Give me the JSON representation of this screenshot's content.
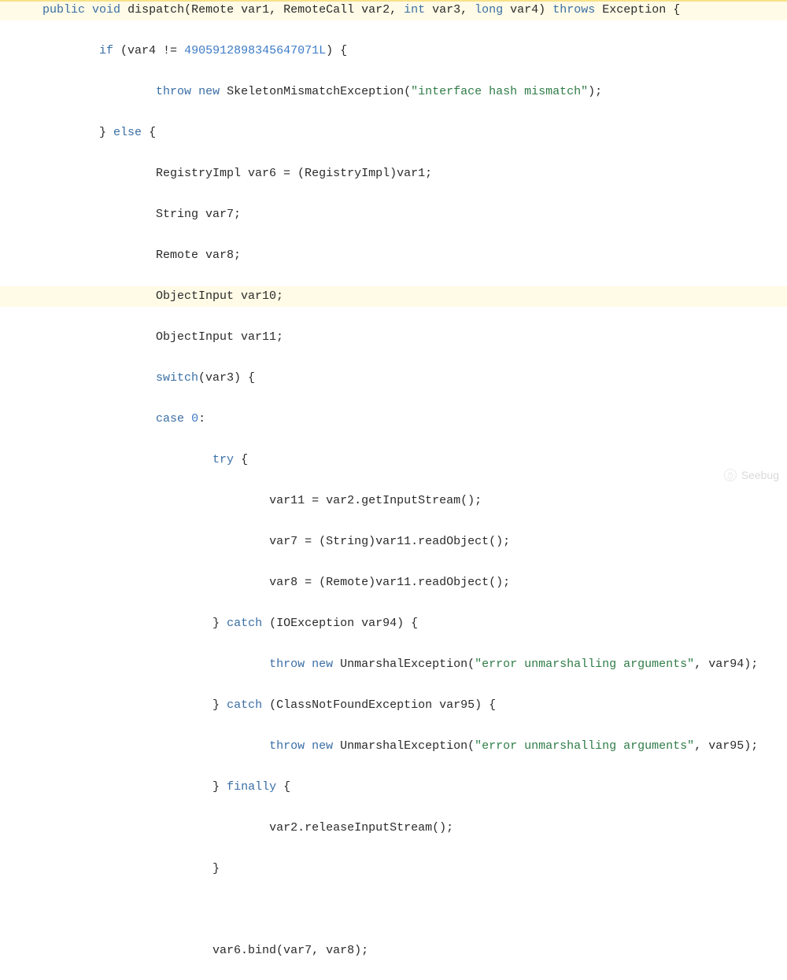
{
  "code": {
    "lines": [
      {
        "hl": "top",
        "indent": 1,
        "tokens": [
          {
            "c": "kw",
            "t": "public"
          },
          {
            "c": "plain",
            "t": " "
          },
          {
            "c": "kw",
            "t": "void"
          },
          {
            "c": "plain",
            "t": " dispatch(Remote var1, RemoteCall var2, "
          },
          {
            "c": "kw",
            "t": "int"
          },
          {
            "c": "plain",
            "t": " var3, "
          },
          {
            "c": "kw",
            "t": "long"
          },
          {
            "c": "plain",
            "t": " var4) "
          },
          {
            "c": "kw",
            "t": "throws"
          },
          {
            "c": "plain",
            "t": " Exception {"
          }
        ]
      },
      {
        "indent": 3,
        "tokens": [
          {
            "c": "kw",
            "t": "if"
          },
          {
            "c": "plain",
            "t": " (var4 != "
          },
          {
            "c": "num",
            "t": "4905912898345647071L"
          },
          {
            "c": "plain",
            "t": ") {"
          }
        ]
      },
      {
        "indent": 5,
        "tokens": [
          {
            "c": "kw",
            "t": "throw"
          },
          {
            "c": "plain",
            "t": " "
          },
          {
            "c": "kw",
            "t": "new"
          },
          {
            "c": "plain",
            "t": " SkeletonMismatchException("
          },
          {
            "c": "str",
            "t": "\"interface hash mismatch\""
          },
          {
            "c": "plain",
            "t": ");"
          }
        ]
      },
      {
        "indent": 3,
        "tokens": [
          {
            "c": "plain",
            "t": "} "
          },
          {
            "c": "kw",
            "t": "else"
          },
          {
            "c": "plain",
            "t": " {"
          }
        ]
      },
      {
        "indent": 5,
        "tokens": [
          {
            "c": "plain",
            "t": "RegistryImpl var6 = (RegistryImpl)var1;"
          }
        ]
      },
      {
        "indent": 5,
        "tokens": [
          {
            "c": "plain",
            "t": "String var7;"
          }
        ]
      },
      {
        "indent": 5,
        "tokens": [
          {
            "c": "plain",
            "t": "Remote var8;"
          }
        ]
      },
      {
        "hl": "line",
        "indent": 5,
        "tokens": [
          {
            "c": "plain",
            "t": "ObjectInput var10;"
          }
        ]
      },
      {
        "indent": 5,
        "tokens": [
          {
            "c": "plain",
            "t": "ObjectInput var11;"
          }
        ]
      },
      {
        "indent": 5,
        "tokens": [
          {
            "c": "kw",
            "t": "switch"
          },
          {
            "c": "plain",
            "t": "(var3) {"
          }
        ]
      },
      {
        "indent": 5,
        "tokens": [
          {
            "c": "kw",
            "t": "case"
          },
          {
            "c": "plain",
            "t": " "
          },
          {
            "c": "num",
            "t": "0"
          },
          {
            "c": "plain",
            "t": ":"
          }
        ]
      },
      {
        "indent": 7,
        "tokens": [
          {
            "c": "kw",
            "t": "try"
          },
          {
            "c": "plain",
            "t": " {"
          }
        ]
      },
      {
        "indent": 9,
        "tokens": [
          {
            "c": "plain",
            "t": "var11 = var2.getInputStream();"
          }
        ]
      },
      {
        "indent": 9,
        "tokens": [
          {
            "c": "plain",
            "t": "var7 = (String)var11.readObject();"
          }
        ]
      },
      {
        "indent": 9,
        "tokens": [
          {
            "c": "plain",
            "t": "var8 = (Remote)var11.readObject();"
          }
        ]
      },
      {
        "indent": 7,
        "tokens": [
          {
            "c": "plain",
            "t": "} "
          },
          {
            "c": "kw",
            "t": "catch"
          },
          {
            "c": "plain",
            "t": " (IOException var94) {"
          }
        ]
      },
      {
        "indent": 9,
        "tokens": [
          {
            "c": "kw",
            "t": "throw"
          },
          {
            "c": "plain",
            "t": " "
          },
          {
            "c": "kw",
            "t": "new"
          },
          {
            "c": "plain",
            "t": " UnmarshalException("
          },
          {
            "c": "str",
            "t": "\"error unmarshalling arguments\""
          },
          {
            "c": "plain",
            "t": ", var94);"
          }
        ]
      },
      {
        "indent": 7,
        "tokens": [
          {
            "c": "plain",
            "t": "} "
          },
          {
            "c": "kw",
            "t": "catch"
          },
          {
            "c": "plain",
            "t": " (ClassNotFoundException var95) {"
          }
        ]
      },
      {
        "indent": 9,
        "tokens": [
          {
            "c": "kw",
            "t": "throw"
          },
          {
            "c": "plain",
            "t": " "
          },
          {
            "c": "kw",
            "t": "new"
          },
          {
            "c": "plain",
            "t": " UnmarshalException("
          },
          {
            "c": "str",
            "t": "\"error unmarshalling arguments\""
          },
          {
            "c": "plain",
            "t": ", var95);"
          }
        ]
      },
      {
        "indent": 7,
        "tokens": [
          {
            "c": "plain",
            "t": "} "
          },
          {
            "c": "kw",
            "t": "finally"
          },
          {
            "c": "plain",
            "t": " {"
          }
        ]
      },
      {
        "indent": 9,
        "tokens": [
          {
            "c": "plain",
            "t": "var2.releaseInputStream();"
          }
        ]
      },
      {
        "indent": 7,
        "tokens": [
          {
            "c": "plain",
            "t": "}"
          }
        ]
      },
      {
        "indent": 7,
        "tokens": [
          {
            "c": "plain",
            "t": ""
          }
        ]
      },
      {
        "indent": 7,
        "tokens": [
          {
            "c": "plain",
            "t": "var6.bind(var7, var8);"
          }
        ]
      }
    ]
  },
  "watermark": {
    "text": "Seebug"
  }
}
